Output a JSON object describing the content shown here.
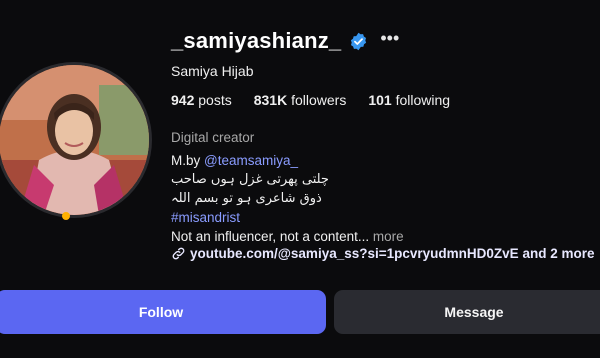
{
  "profile": {
    "username": "_samiyashianz_",
    "full_name": "Samiya Hijab",
    "verified": true,
    "more_icon": "•••",
    "stats": {
      "posts_count": "942",
      "posts_label": "posts",
      "followers_count": "831K",
      "followers_label": "followers",
      "following_count": "101",
      "following_label": "following"
    },
    "category": "Digital creator",
    "bio": {
      "mention_prefix": "M.by ",
      "mention": "@teamsamiya_",
      "urdu_line_1": "چلتی پھرتی غزل ہوں صاحب",
      "urdu_line_2": "ذوق شاعری ہو تو بسم اللہ",
      "hashtag": "#misandrist",
      "tagline": "Not an influencer, not a content...",
      "more_label": "more"
    },
    "website": {
      "url": "youtube.com/@samiya_ss?si=1pcvryudmnHD0ZvE",
      "suffix": "and 2 more"
    }
  },
  "actions": {
    "follow_label": "Follow",
    "message_label": "Message"
  },
  "colors": {
    "background": "#0b0b0d",
    "follow_button": "#5b67f2",
    "message_button": "#2a2b31",
    "link": "#8a9cff",
    "verified_badge": "#3897f0",
    "muted_text": "#a8a8a8"
  },
  "icons": {
    "verified": "verified-badge-icon",
    "more": "more-options-icon",
    "link": "link-chain-icon"
  }
}
